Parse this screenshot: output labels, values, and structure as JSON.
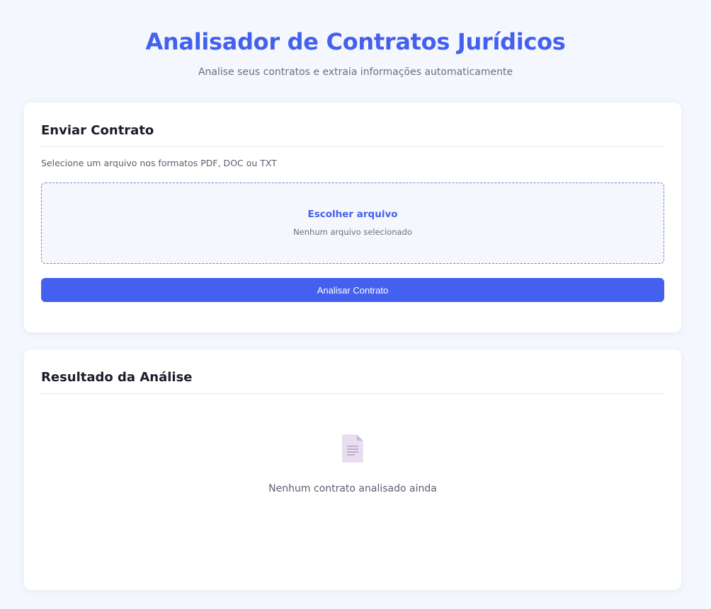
{
  "header": {
    "title": "Analisador de Contratos Jurídicos",
    "subtitle": "Analise seus contratos e extraia informações automaticamente"
  },
  "upload": {
    "title": "Enviar Contrato",
    "hint": "Selecione um arquivo nos formatos PDF, DOC ou TXT",
    "choose_label": "Escolher arquivo",
    "no_file": "Nenhum arquivo selecionado",
    "analyze_label": "Analisar Contrato"
  },
  "result": {
    "title": "Resultado da Análise",
    "empty_icon": "document-icon",
    "empty_text": "Nenhum contrato analisado ainda"
  },
  "colors": {
    "accent": "#4361ee",
    "background": "#f4f7fe",
    "card": "#ffffff"
  }
}
